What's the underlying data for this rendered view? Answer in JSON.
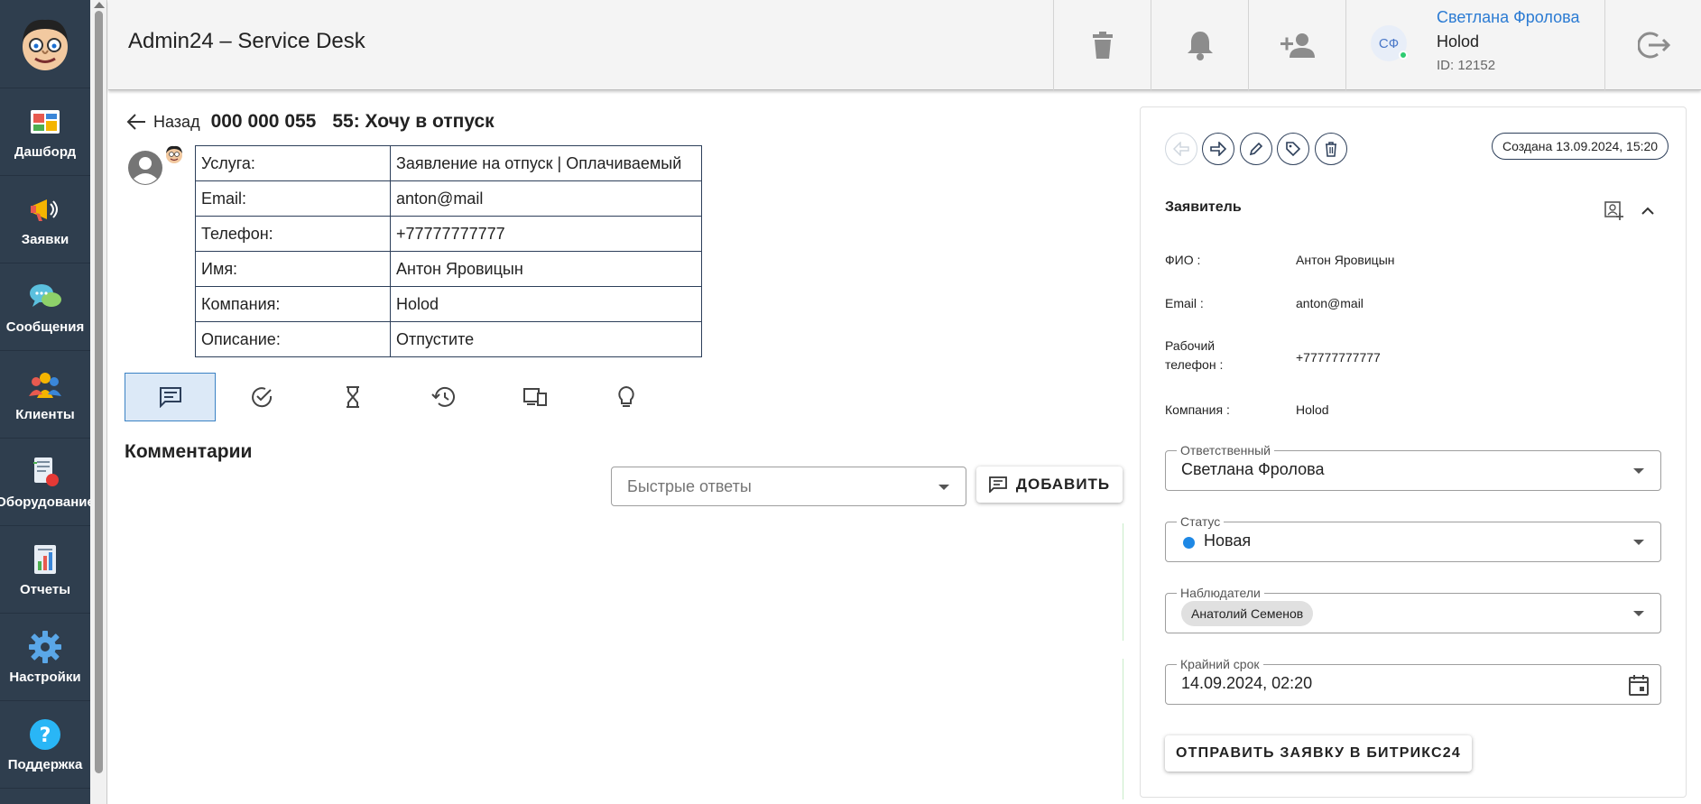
{
  "app": {
    "title": "Admin24 – Service Desk"
  },
  "sidebar": {
    "items": [
      {
        "label": "Дашборд",
        "icon": "dashboard-icon"
      },
      {
        "label": "Заявки",
        "icon": "megaphone-icon"
      },
      {
        "label": "Сообщения",
        "icon": "chat-bubbles-icon"
      },
      {
        "label": "Клиенты",
        "icon": "clients-icon"
      },
      {
        "label": "Оборудование",
        "icon": "equipment-icon"
      },
      {
        "label": "Отчеты",
        "icon": "report-icon"
      },
      {
        "label": "Настройки",
        "icon": "gear-icon"
      },
      {
        "label": "Поддержка",
        "icon": "help-icon"
      }
    ]
  },
  "header": {
    "user": {
      "initials": "СФ",
      "name": "Светлана Фролова",
      "company": "Holod",
      "id": "ID: 12152"
    }
  },
  "ticket": {
    "back_label": "Назад",
    "number": "000 000 055",
    "title": "55: Хочу в отпуск",
    "info": [
      {
        "key": "Услуга:",
        "value": "Заявление на отпуск | Оплачиваемый"
      },
      {
        "key": "Email:",
        "value": "anton@mail"
      },
      {
        "key": "Телефон:",
        "value": "+77777777777"
      },
      {
        "key": "Имя:",
        "value": "Антон Яровицын"
      },
      {
        "key": "Компания:",
        "value": "Holod"
      },
      {
        "key": "Описание:",
        "value": "Отпустите"
      }
    ]
  },
  "comments": {
    "title": "Комментарии",
    "quick_replies_placeholder": "Быстрые ответы",
    "add_label": "ДОБАВИТЬ"
  },
  "panel": {
    "created": "Создана 13.09.2024, 15:20",
    "applicant_title": "Заявитель",
    "fields": [
      {
        "label": "ФИО :",
        "value": "Антон Яровицын"
      },
      {
        "label": "Email :",
        "value": "anton@mail"
      },
      {
        "label_line1": "Рабочий",
        "label_line2": "телефон :",
        "value": "+77777777777"
      },
      {
        "label": "Компания :",
        "value": "Holod"
      }
    ],
    "responsible": {
      "label": "Ответственный",
      "value": "Светлана Фролова"
    },
    "status": {
      "label": "Статус",
      "value": "Новая",
      "color": "#1e88e5"
    },
    "watchers": {
      "label": "Наблюдатели",
      "chip": "Анатолий Семенов"
    },
    "deadline": {
      "label": "Крайний срок",
      "value": "14.09.2024, 02:20"
    },
    "send_label": "ОТПРАВИТЬ ЗАЯВКУ В БИТРИКС24"
  },
  "colors": {
    "sidebar_bg": "#2f3e4e",
    "accent": "#2b7bd3",
    "online": "#2ecc71"
  }
}
